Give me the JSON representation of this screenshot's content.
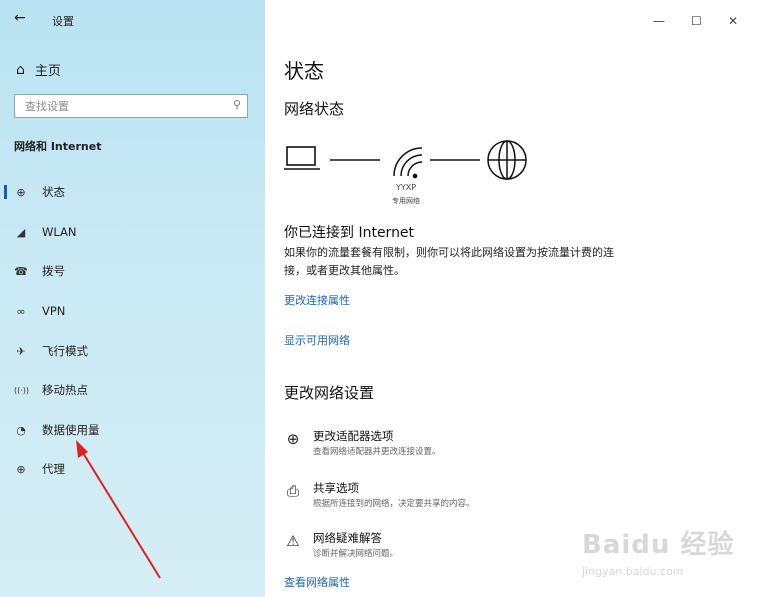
{
  "window": {
    "title": "设置",
    "back_icon": "←",
    "minimize": "—",
    "maximize": "☐",
    "close": "✕"
  },
  "sidebar": {
    "home_label": "主页",
    "search_placeholder": "查找设置",
    "section_title": "网络和 Internet",
    "items": [
      {
        "icon": "globe-filled-icon",
        "glyph": "⊕",
        "label": "状态",
        "active": true
      },
      {
        "icon": "wifi-icon",
        "glyph": "◢",
        "label": "WLAN"
      },
      {
        "icon": "dialup-icon",
        "glyph": "☎",
        "label": "拨号"
      },
      {
        "icon": "vpn-icon",
        "glyph": "∞",
        "label": "VPN"
      },
      {
        "icon": "airplane-icon",
        "glyph": "✈",
        "label": "飞行模式"
      },
      {
        "icon": "hotspot-icon",
        "glyph": "((·))",
        "label": "移动热点"
      },
      {
        "icon": "data-usage-icon",
        "glyph": "◔",
        "label": "数据使用量"
      },
      {
        "icon": "proxy-icon",
        "glyph": "⊕",
        "label": "代理"
      }
    ]
  },
  "main": {
    "title": "状态",
    "network_status_heading": "网络状态",
    "ssid": "YYXP",
    "ssid_type": "专用网络",
    "connected_text": "你已连接到 Internet",
    "description": "如果你的流量套餐有限制，则你可以将此网络设置为按流量计费的连接，或者更改其他属性。",
    "link_change_props": "更改连接属性",
    "link_show_networks": "显示可用网络",
    "change_settings_heading": "更改网络设置",
    "options": [
      {
        "icon": "adapter-icon",
        "glyph": "⊕",
        "title": "更改适配器选项",
        "subtitle": "查看网络适配器并更改连接设置。"
      },
      {
        "icon": "sharing-icon",
        "glyph": "⎙",
        "title": "共享选项",
        "subtitle": "根据所连接到的网络，决定要共享的内容。"
      },
      {
        "icon": "warning-icon",
        "glyph": "⚠",
        "title": "网络疑难解答",
        "subtitle": "诊断并解决网络问题。"
      }
    ],
    "link_view_props": "查看网络属性"
  },
  "watermark": {
    "line1": "Baidu 经验",
    "line2": "jingyan.baidu.com"
  }
}
